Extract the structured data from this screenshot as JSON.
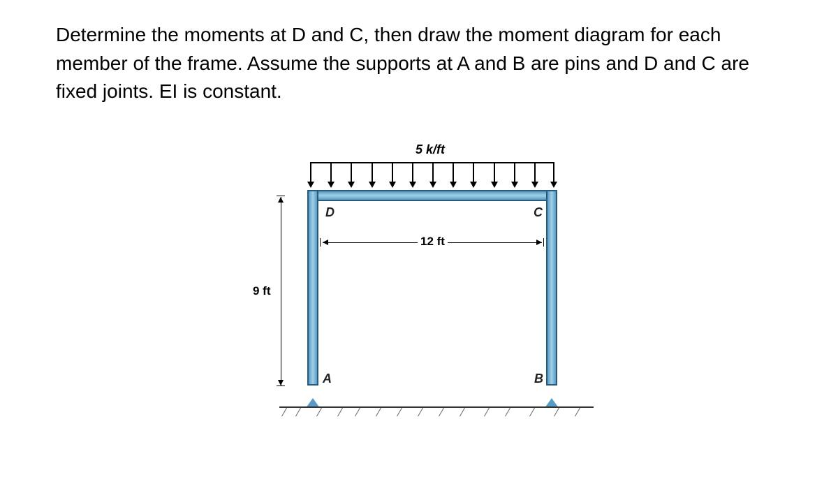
{
  "problem": {
    "text": "Determine the moments at D and C, then draw the moment diagram for each member of the frame. Assume the supports at A and B are pins and D and C are fixed joints. EI is constant."
  },
  "diagram": {
    "load_label": "5 k/ft",
    "joints": {
      "A": "A",
      "B": "B",
      "C": "C",
      "D": "D"
    },
    "dimensions": {
      "height": "9 ft",
      "width": "12 ft"
    }
  },
  "chart_data": {
    "type": "diagram",
    "structure": "portal-frame",
    "supports": [
      {
        "name": "A",
        "type": "pin",
        "location": "bottom-left"
      },
      {
        "name": "B",
        "type": "pin",
        "location": "bottom-right"
      }
    ],
    "joints": [
      {
        "name": "D",
        "type": "fixed",
        "location": "top-left"
      },
      {
        "name": "C",
        "type": "fixed",
        "location": "top-right"
      }
    ],
    "members": [
      {
        "from": "A",
        "to": "D",
        "length_ft": 9,
        "orientation": "vertical"
      },
      {
        "from": "D",
        "to": "C",
        "length_ft": 12,
        "orientation": "horizontal"
      },
      {
        "from": "C",
        "to": "B",
        "length_ft": 9,
        "orientation": "vertical"
      }
    ],
    "loads": [
      {
        "type": "uniform-distributed",
        "member": "DC",
        "magnitude_k_per_ft": 5,
        "direction": "down"
      }
    ],
    "EI": "constant"
  }
}
